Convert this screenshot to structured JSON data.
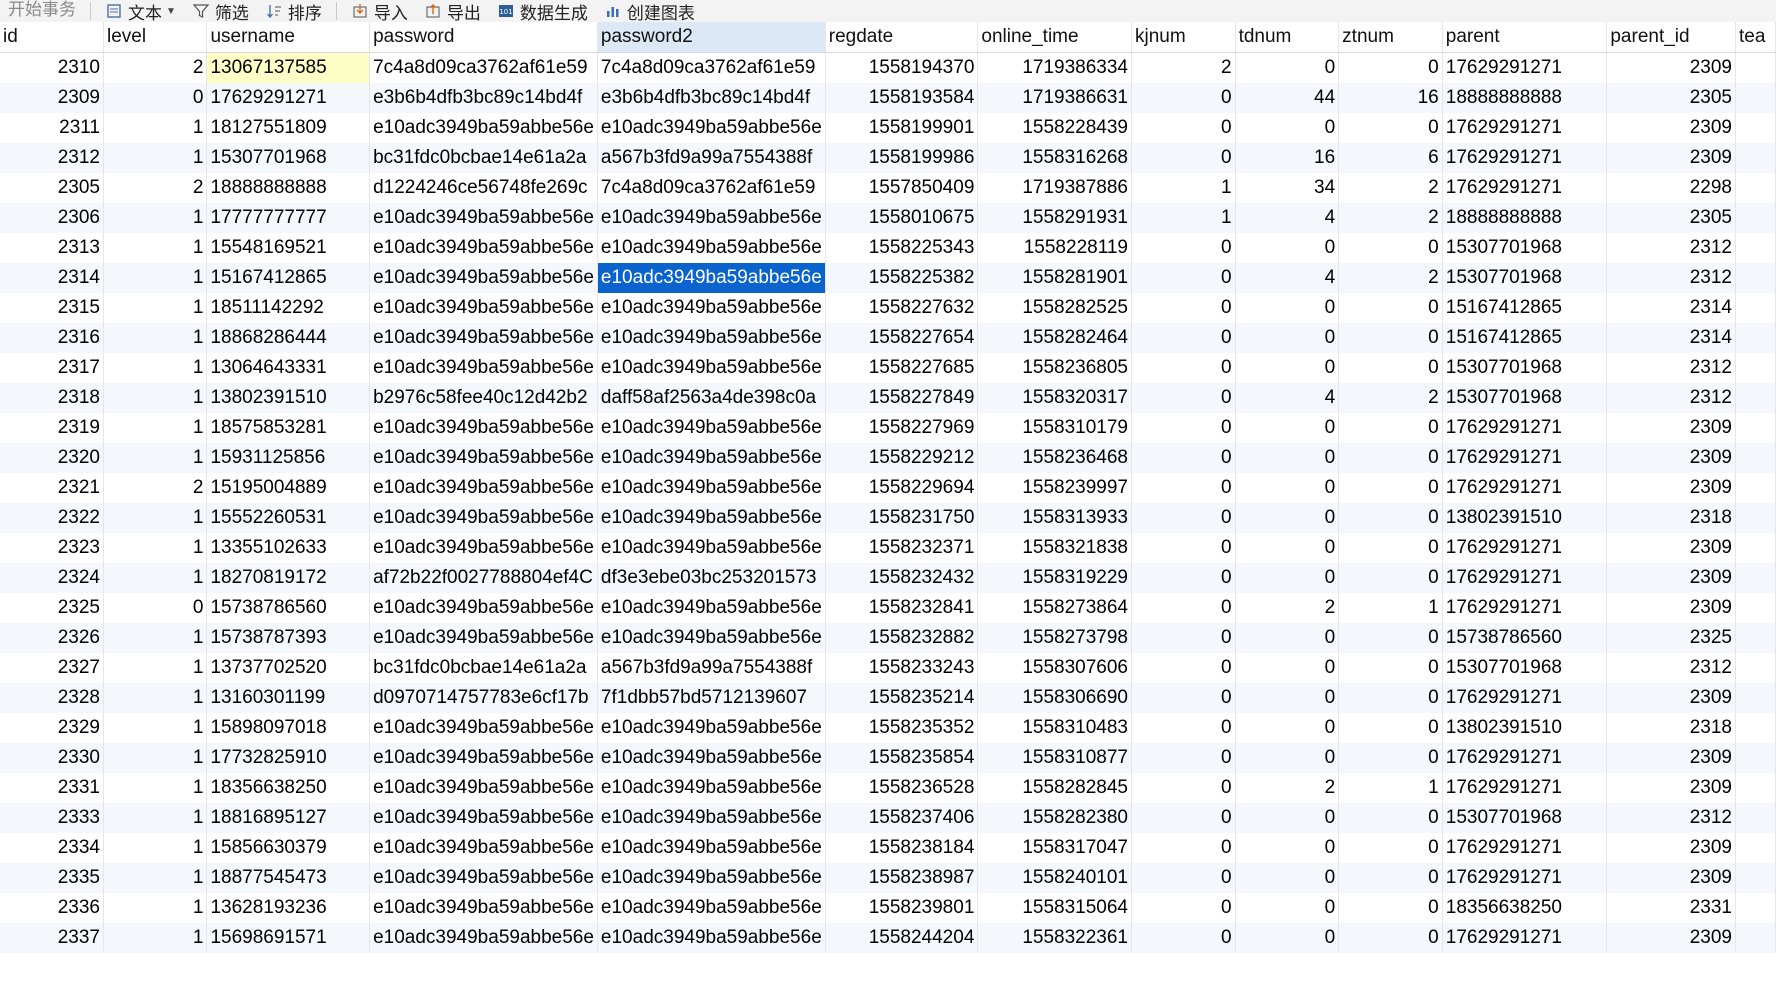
{
  "toolbar": {
    "start_tx": "开始事务",
    "text": "文本",
    "filter": "筛选",
    "sort": "排序",
    "import": "导入",
    "export": "导出",
    "datagen": "数据生成",
    "chart": "创建图表"
  },
  "columns": [
    "id",
    "level",
    "username",
    "password",
    "password2",
    "regdate",
    "online_time",
    "kjnum",
    "tdnum",
    "ztnum",
    "parent",
    "parent_id",
    "tea"
  ],
  "rows": [
    [
      "2310",
      "2",
      "13067137585",
      "7c4a8d09ca3762af61e59",
      "7c4a8d09ca3762af61e59",
      "1558194370",
      "1719386334",
      "2",
      "0",
      "0",
      "17629291271",
      "2309"
    ],
    [
      "2309",
      "0",
      "17629291271",
      "e3b6b4dfb3bc89c14bd4f",
      "e3b6b4dfb3bc89c14bd4f",
      "1558193584",
      "1719386631",
      "0",
      "44",
      "16",
      "18888888888",
      "2305"
    ],
    [
      "2311",
      "1",
      "18127551809",
      "e10adc3949ba59abbe56e",
      "e10adc3949ba59abbe56e",
      "1558199901",
      "1558228439",
      "0",
      "0",
      "0",
      "17629291271",
      "2309"
    ],
    [
      "2312",
      "1",
      "15307701968",
      "bc31fdc0bcbae14e61a2a",
      "a567b3fd9a99a7554388f",
      "1558199986",
      "1558316268",
      "0",
      "16",
      "6",
      "17629291271",
      "2309"
    ],
    [
      "2305",
      "2",
      "18888888888",
      "d1224246ce56748fe269c",
      "7c4a8d09ca3762af61e59",
      "1557850409",
      "1719387886",
      "1",
      "34",
      "2",
      "17629291271",
      "2298"
    ],
    [
      "2306",
      "1",
      "17777777777",
      "e10adc3949ba59abbe56e",
      "e10adc3949ba59abbe56e",
      "1558010675",
      "1558291931",
      "1",
      "4",
      "2",
      "18888888888",
      "2305"
    ],
    [
      "2313",
      "1",
      "15548169521",
      "e10adc3949ba59abbe56e",
      "e10adc3949ba59abbe56e",
      "1558225343",
      "1558228119",
      "0",
      "0",
      "0",
      "15307701968",
      "2312"
    ],
    [
      "2314",
      "1",
      "15167412865",
      "e10adc3949ba59abbe56e",
      "e10adc3949ba59abbe56e",
      "1558225382",
      "1558281901",
      "0",
      "4",
      "2",
      "15307701968",
      "2312"
    ],
    [
      "2315",
      "1",
      "18511142292",
      "e10adc3949ba59abbe56e",
      "e10adc3949ba59abbe56e",
      "1558227632",
      "1558282525",
      "0",
      "0",
      "0",
      "15167412865",
      "2314"
    ],
    [
      "2316",
      "1",
      "18868286444",
      "e10adc3949ba59abbe56e",
      "e10adc3949ba59abbe56e",
      "1558227654",
      "1558282464",
      "0",
      "0",
      "0",
      "15167412865",
      "2314"
    ],
    [
      "2317",
      "1",
      "13064643331",
      "e10adc3949ba59abbe56e",
      "e10adc3949ba59abbe56e",
      "1558227685",
      "1558236805",
      "0",
      "0",
      "0",
      "15307701968",
      "2312"
    ],
    [
      "2318",
      "1",
      "13802391510",
      "b2976c58fee40c12d42b2",
      "daff58af2563a4de398c0a",
      "1558227849",
      "1558320317",
      "0",
      "4",
      "2",
      "15307701968",
      "2312"
    ],
    [
      "2319",
      "1",
      "18575853281",
      "e10adc3949ba59abbe56e",
      "e10adc3949ba59abbe56e",
      "1558227969",
      "1558310179",
      "0",
      "0",
      "0",
      "17629291271",
      "2309"
    ],
    [
      "2320",
      "1",
      "15931125856",
      "e10adc3949ba59abbe56e",
      "e10adc3949ba59abbe56e",
      "1558229212",
      "1558236468",
      "0",
      "0",
      "0",
      "17629291271",
      "2309"
    ],
    [
      "2321",
      "2",
      "15195004889",
      "e10adc3949ba59abbe56e",
      "e10adc3949ba59abbe56e",
      "1558229694",
      "1558239997",
      "0",
      "0",
      "0",
      "17629291271",
      "2309"
    ],
    [
      "2322",
      "1",
      "15552260531",
      "e10adc3949ba59abbe56e",
      "e10adc3949ba59abbe56e",
      "1558231750",
      "1558313933",
      "0",
      "0",
      "0",
      "13802391510",
      "2318"
    ],
    [
      "2323",
      "1",
      "13355102633",
      "e10adc3949ba59abbe56e",
      "e10adc3949ba59abbe56e",
      "1558232371",
      "1558321838",
      "0",
      "0",
      "0",
      "17629291271",
      "2309"
    ],
    [
      "2324",
      "1",
      "18270819172",
      "af72b22f0027788804ef4C",
      "df3e3ebe03bc253201573",
      "1558232432",
      "1558319229",
      "0",
      "0",
      "0",
      "17629291271",
      "2309"
    ],
    [
      "2325",
      "0",
      "15738786560",
      "e10adc3949ba59abbe56e",
      "e10adc3949ba59abbe56e",
      "1558232841",
      "1558273864",
      "0",
      "2",
      "1",
      "17629291271",
      "2309"
    ],
    [
      "2326",
      "1",
      "15738787393",
      "e10adc3949ba59abbe56e",
      "e10adc3949ba59abbe56e",
      "1558232882",
      "1558273798",
      "0",
      "0",
      "0",
      "15738786560",
      "2325"
    ],
    [
      "2327",
      "1",
      "13737702520",
      "bc31fdc0bcbae14e61a2a",
      "a567b3fd9a99a7554388f",
      "1558233243",
      "1558307606",
      "0",
      "0",
      "0",
      "15307701968",
      "2312"
    ],
    [
      "2328",
      "1",
      "13160301199",
      "d0970714757783e6cf17b",
      "7f1dbb57bd5712139607",
      "1558235214",
      "1558306690",
      "0",
      "0",
      "0",
      "17629291271",
      "2309"
    ],
    [
      "2329",
      "1",
      "15898097018",
      "e10adc3949ba59abbe56e",
      "e10adc3949ba59abbe56e",
      "1558235352",
      "1558310483",
      "0",
      "0",
      "0",
      "13802391510",
      "2318"
    ],
    [
      "2330",
      "1",
      "17732825910",
      "e10adc3949ba59abbe56e",
      "e10adc3949ba59abbe56e",
      "1558235854",
      "1558310877",
      "0",
      "0",
      "0",
      "17629291271",
      "2309"
    ],
    [
      "2331",
      "1",
      "18356638250",
      "e10adc3949ba59abbe56e",
      "e10adc3949ba59abbe56e",
      "1558236528",
      "1558282845",
      "0",
      "2",
      "1",
      "17629291271",
      "2309"
    ],
    [
      "2333",
      "1",
      "18816895127",
      "e10adc3949ba59abbe56e",
      "e10adc3949ba59abbe56e",
      "1558237406",
      "1558282380",
      "0",
      "0",
      "0",
      "15307701968",
      "2312"
    ],
    [
      "2334",
      "1",
      "15856630379",
      "e10adc3949ba59abbe56e",
      "e10adc3949ba59abbe56e",
      "1558238184",
      "1558317047",
      "0",
      "0",
      "0",
      "17629291271",
      "2309"
    ],
    [
      "2335",
      "1",
      "18877545473",
      "e10adc3949ba59abbe56e",
      "e10adc3949ba59abbe56e",
      "1558238987",
      "1558240101",
      "0",
      "0",
      "0",
      "17629291271",
      "2309"
    ],
    [
      "2336",
      "1",
      "13628193236",
      "e10adc3949ba59abbe56e",
      "e10adc3949ba59abbe56e",
      "1558239801",
      "1558315064",
      "0",
      "0",
      "0",
      "18356638250",
      "2331"
    ],
    [
      "2337",
      "1",
      "15698691571",
      "e10adc3949ba59abbe56e",
      "e10adc3949ba59abbe56e",
      "1558244204",
      "1558322361",
      "0",
      "0",
      "0",
      "17629291271",
      "2309"
    ]
  ],
  "colors": {
    "selected_cell": "#0b63ce",
    "edit_cell": "#fdfdc6",
    "selected_header": "#dde8f6",
    "alt_row": "#f4f8fd"
  }
}
